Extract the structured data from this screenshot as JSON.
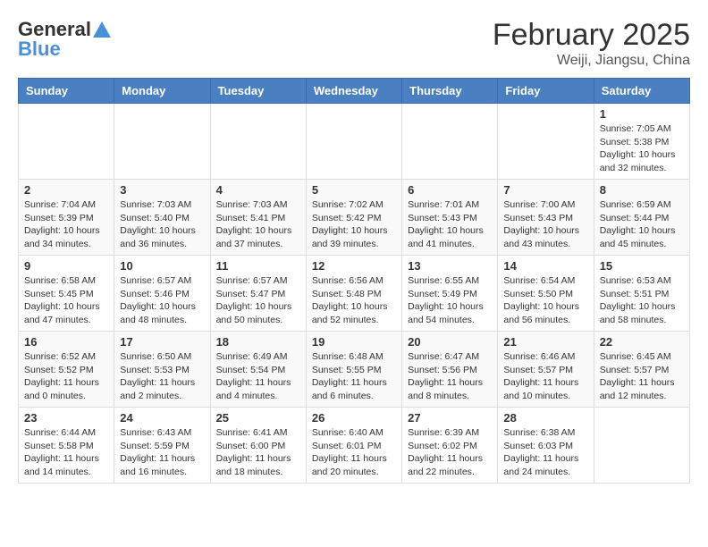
{
  "header": {
    "logo_general": "General",
    "logo_blue": "Blue",
    "month_year": "February 2025",
    "location": "Weiji, Jiangsu, China"
  },
  "days_of_week": [
    "Sunday",
    "Monday",
    "Tuesday",
    "Wednesday",
    "Thursday",
    "Friday",
    "Saturday"
  ],
  "weeks": [
    [
      {
        "day": "",
        "info": ""
      },
      {
        "day": "",
        "info": ""
      },
      {
        "day": "",
        "info": ""
      },
      {
        "day": "",
        "info": ""
      },
      {
        "day": "",
        "info": ""
      },
      {
        "day": "",
        "info": ""
      },
      {
        "day": "1",
        "info": "Sunrise: 7:05 AM\nSunset: 5:38 PM\nDaylight: 10 hours\nand 32 minutes."
      }
    ],
    [
      {
        "day": "2",
        "info": "Sunrise: 7:04 AM\nSunset: 5:39 PM\nDaylight: 10 hours\nand 34 minutes."
      },
      {
        "day": "3",
        "info": "Sunrise: 7:03 AM\nSunset: 5:40 PM\nDaylight: 10 hours\nand 36 minutes."
      },
      {
        "day": "4",
        "info": "Sunrise: 7:03 AM\nSunset: 5:41 PM\nDaylight: 10 hours\nand 37 minutes."
      },
      {
        "day": "5",
        "info": "Sunrise: 7:02 AM\nSunset: 5:42 PM\nDaylight: 10 hours\nand 39 minutes."
      },
      {
        "day": "6",
        "info": "Sunrise: 7:01 AM\nSunset: 5:43 PM\nDaylight: 10 hours\nand 41 minutes."
      },
      {
        "day": "7",
        "info": "Sunrise: 7:00 AM\nSunset: 5:43 PM\nDaylight: 10 hours\nand 43 minutes."
      },
      {
        "day": "8",
        "info": "Sunrise: 6:59 AM\nSunset: 5:44 PM\nDaylight: 10 hours\nand 45 minutes."
      }
    ],
    [
      {
        "day": "9",
        "info": "Sunrise: 6:58 AM\nSunset: 5:45 PM\nDaylight: 10 hours\nand 47 minutes."
      },
      {
        "day": "10",
        "info": "Sunrise: 6:57 AM\nSunset: 5:46 PM\nDaylight: 10 hours\nand 48 minutes."
      },
      {
        "day": "11",
        "info": "Sunrise: 6:57 AM\nSunset: 5:47 PM\nDaylight: 10 hours\nand 50 minutes."
      },
      {
        "day": "12",
        "info": "Sunrise: 6:56 AM\nSunset: 5:48 PM\nDaylight: 10 hours\nand 52 minutes."
      },
      {
        "day": "13",
        "info": "Sunrise: 6:55 AM\nSunset: 5:49 PM\nDaylight: 10 hours\nand 54 minutes."
      },
      {
        "day": "14",
        "info": "Sunrise: 6:54 AM\nSunset: 5:50 PM\nDaylight: 10 hours\nand 56 minutes."
      },
      {
        "day": "15",
        "info": "Sunrise: 6:53 AM\nSunset: 5:51 PM\nDaylight: 10 hours\nand 58 minutes."
      }
    ],
    [
      {
        "day": "16",
        "info": "Sunrise: 6:52 AM\nSunset: 5:52 PM\nDaylight: 11 hours\nand 0 minutes."
      },
      {
        "day": "17",
        "info": "Sunrise: 6:50 AM\nSunset: 5:53 PM\nDaylight: 11 hours\nand 2 minutes."
      },
      {
        "day": "18",
        "info": "Sunrise: 6:49 AM\nSunset: 5:54 PM\nDaylight: 11 hours\nand 4 minutes."
      },
      {
        "day": "19",
        "info": "Sunrise: 6:48 AM\nSunset: 5:55 PM\nDaylight: 11 hours\nand 6 minutes."
      },
      {
        "day": "20",
        "info": "Sunrise: 6:47 AM\nSunset: 5:56 PM\nDaylight: 11 hours\nand 8 minutes."
      },
      {
        "day": "21",
        "info": "Sunrise: 6:46 AM\nSunset: 5:57 PM\nDaylight: 11 hours\nand 10 minutes."
      },
      {
        "day": "22",
        "info": "Sunrise: 6:45 AM\nSunset: 5:57 PM\nDaylight: 11 hours\nand 12 minutes."
      }
    ],
    [
      {
        "day": "23",
        "info": "Sunrise: 6:44 AM\nSunset: 5:58 PM\nDaylight: 11 hours\nand 14 minutes."
      },
      {
        "day": "24",
        "info": "Sunrise: 6:43 AM\nSunset: 5:59 PM\nDaylight: 11 hours\nand 16 minutes."
      },
      {
        "day": "25",
        "info": "Sunrise: 6:41 AM\nSunset: 6:00 PM\nDaylight: 11 hours\nand 18 minutes."
      },
      {
        "day": "26",
        "info": "Sunrise: 6:40 AM\nSunset: 6:01 PM\nDaylight: 11 hours\nand 20 minutes."
      },
      {
        "day": "27",
        "info": "Sunrise: 6:39 AM\nSunset: 6:02 PM\nDaylight: 11 hours\nand 22 minutes."
      },
      {
        "day": "28",
        "info": "Sunrise: 6:38 AM\nSunset: 6:03 PM\nDaylight: 11 hours\nand 24 minutes."
      },
      {
        "day": "",
        "info": ""
      }
    ]
  ]
}
